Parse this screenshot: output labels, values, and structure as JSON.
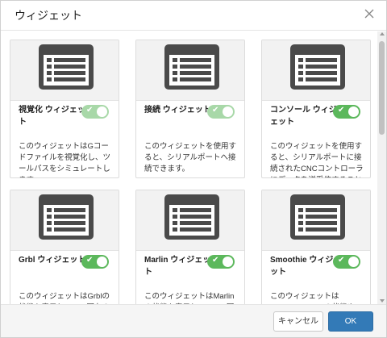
{
  "dialog": {
    "title": "ウィジェット",
    "close_icon": "close-icon"
  },
  "widgets": [
    {
      "title": "視覚化 ウィジェット",
      "enabled": true,
      "desc": "このウィジェットはGコードファイルを視覚化し、ツールパスをシミュレートします。",
      "icon": "widget-panel-icon"
    },
    {
      "title": "接続 ウィジェット",
      "enabled": true,
      "desc": "このウィジェットを使用すると、シリアルポートへ接続できます。",
      "icon": "widget-panel-icon"
    },
    {
      "title": "コンソール ウィジェット",
      "enabled": true,
      "desc": "このウィジェットを使用すると、シリアルポートに接続されたCNCコントローラにデータを送受信することができます。",
      "icon": "widget-panel-icon"
    },
    {
      "title": "Grbl ウィジェット",
      "enabled": true,
      "desc": "このウィジェットはGrblの状態を表示し、Grbl固有の",
      "icon": "widget-panel-icon"
    },
    {
      "title": "Marlin ウィジェット",
      "enabled": true,
      "desc": "このウィジェットはMarlinの状態を表示し、Marlin固",
      "icon": "widget-panel-icon"
    },
    {
      "title": "Smoothie ウィジェット",
      "enabled": true,
      "desc": "このウィジェットはSmoothie boardの状態や",
      "icon": "widget-panel-icon"
    }
  ],
  "toggle_check": "✔",
  "footer": {
    "cancel_label": "キャンセル",
    "ok_label": "OK"
  },
  "colors": {
    "toggle_on": "#5cb85c",
    "primary": "#337ab7"
  }
}
